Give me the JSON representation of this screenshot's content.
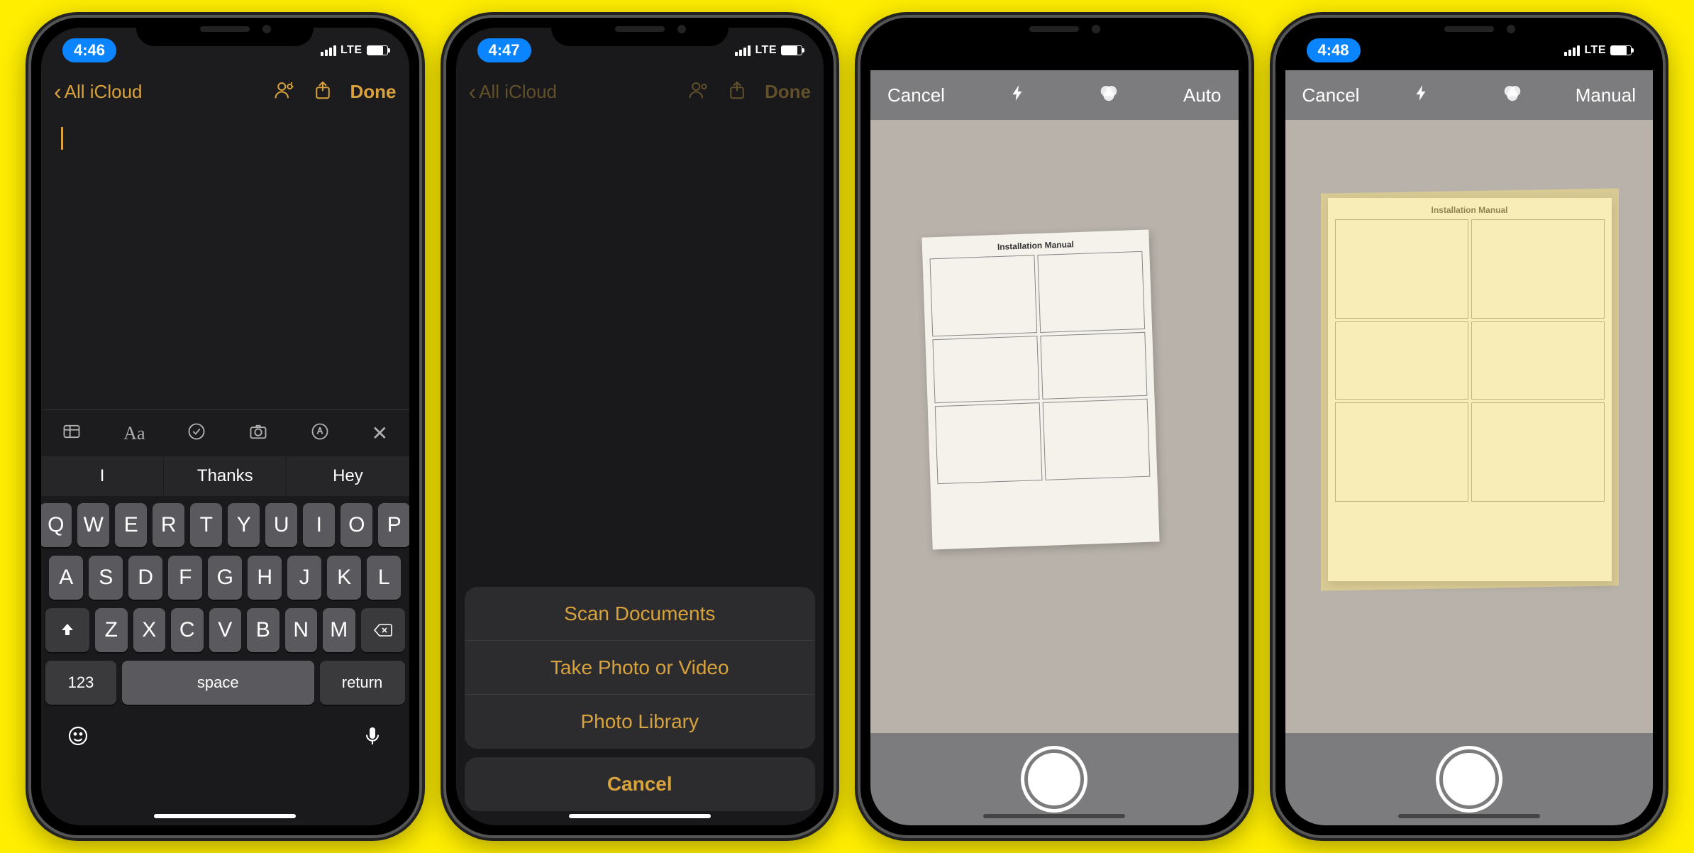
{
  "phones": [
    {
      "time": "4:46",
      "net": "LTE",
      "nav": {
        "back": "All iCloud",
        "done": "Done"
      },
      "toolbar_icons": [
        "table",
        "text-format",
        "checklist",
        "camera",
        "markup",
        "close"
      ],
      "suggestions": [
        "I",
        "Thanks",
        "Hey"
      ],
      "keyboard": {
        "row1": [
          "Q",
          "W",
          "E",
          "R",
          "T",
          "Y",
          "U",
          "I",
          "O",
          "P"
        ],
        "row2": [
          "A",
          "S",
          "D",
          "F",
          "G",
          "H",
          "J",
          "K",
          "L"
        ],
        "row3": [
          "Z",
          "X",
          "C",
          "V",
          "B",
          "N",
          "M"
        ],
        "num": "123",
        "space": "space",
        "ret": "return"
      }
    },
    {
      "time": "4:47",
      "net": "LTE",
      "nav": {
        "back": "All iCloud",
        "done": "Done"
      },
      "sheet": {
        "items": [
          "Scan Documents",
          "Take Photo or Video",
          "Photo Library"
        ],
        "cancel": "Cancel"
      }
    },
    {
      "top": {
        "cancel": "Cancel",
        "mode": "Auto"
      },
      "doc_title": "Installation Manual"
    },
    {
      "time": "4:48",
      "net": "LTE",
      "top": {
        "cancel": "Cancel",
        "mode": "Manual"
      },
      "doc_title": "Installation Manual"
    }
  ]
}
